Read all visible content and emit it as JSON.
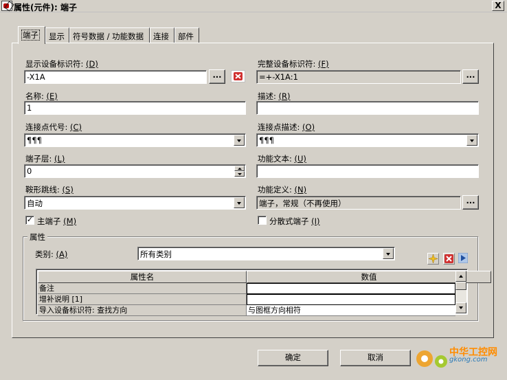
{
  "window": {
    "title": "属性(元件): 端子",
    "close": "X"
  },
  "tabs": [
    {
      "label": "端子",
      "active": true
    },
    {
      "label": "显示"
    },
    {
      "label": "符号数据 / 功能数据"
    },
    {
      "label": "连接"
    },
    {
      "label": "部件"
    }
  ],
  "left": {
    "dt_label": "显示设备标识符: ",
    "dt_key": "(D)",
    "dt_value": "-X1A",
    "name_label": "名称: ",
    "name_key": "(E)",
    "name_value": "1",
    "conn_label": "连接点代号: ",
    "conn_key": "(C)",
    "conn_value": "¶¶¶",
    "layer_label": "端子层: ",
    "layer_key": "(L)",
    "layer_value": "0",
    "jumper_label": "鞍形跳线: ",
    "jumper_key": "(S)",
    "jumper_value": "自动",
    "main_terminal_label": "主端子 ",
    "main_terminal_key": "(M)",
    "main_terminal_checked": "✓"
  },
  "right": {
    "full_dt_label": "完整设备标识符: ",
    "full_dt_key": "(F)",
    "full_dt_value": "=+-X1A:1",
    "desc_label": "描述: ",
    "desc_key": "(R)",
    "desc_value": "",
    "conn_desc_label": "连接点描述: ",
    "conn_desc_key": "(O)",
    "conn_desc_value": "¶¶¶",
    "func_text_label": "功能文本: ",
    "func_text_key": "(U)",
    "func_text_value": "",
    "func_def_label": "功能定义: ",
    "func_def_key": "(N)",
    "func_def_value": "端子，常规（不再使用）",
    "dist_terminal_label": "分散式端子 ",
    "dist_terminal_key": "(I)"
  },
  "buttons": {
    "browse": "...",
    "ok": "确定",
    "cancel": "取消"
  },
  "properties": {
    "group_label": "属性",
    "category_label": "类别: ",
    "category_key": "(A)",
    "category_value": "所有类别",
    "col_name": "属性名",
    "col_value": "数值",
    "rows": [
      {
        "name": "备注",
        "value": ""
      },
      {
        "name": "增补说明 [1]",
        "value": ""
      },
      {
        "name": "导入设备标识符: 查找方向",
        "value": "与图框方向相符"
      }
    ]
  },
  "watermark": {
    "text": "中华工控网",
    "sub": "gkong.com"
  },
  "colors": {
    "dialog_bg": "#d4d0c8",
    "delete_red": "#d03030",
    "new_yellow": "#f0c020",
    "watermark_orange": "#ff8c00"
  },
  "icons": {
    "app": "app-icon",
    "delete": "delete-x-icon",
    "new": "new-star-icon",
    "arrow": "arrow-right-icon"
  }
}
